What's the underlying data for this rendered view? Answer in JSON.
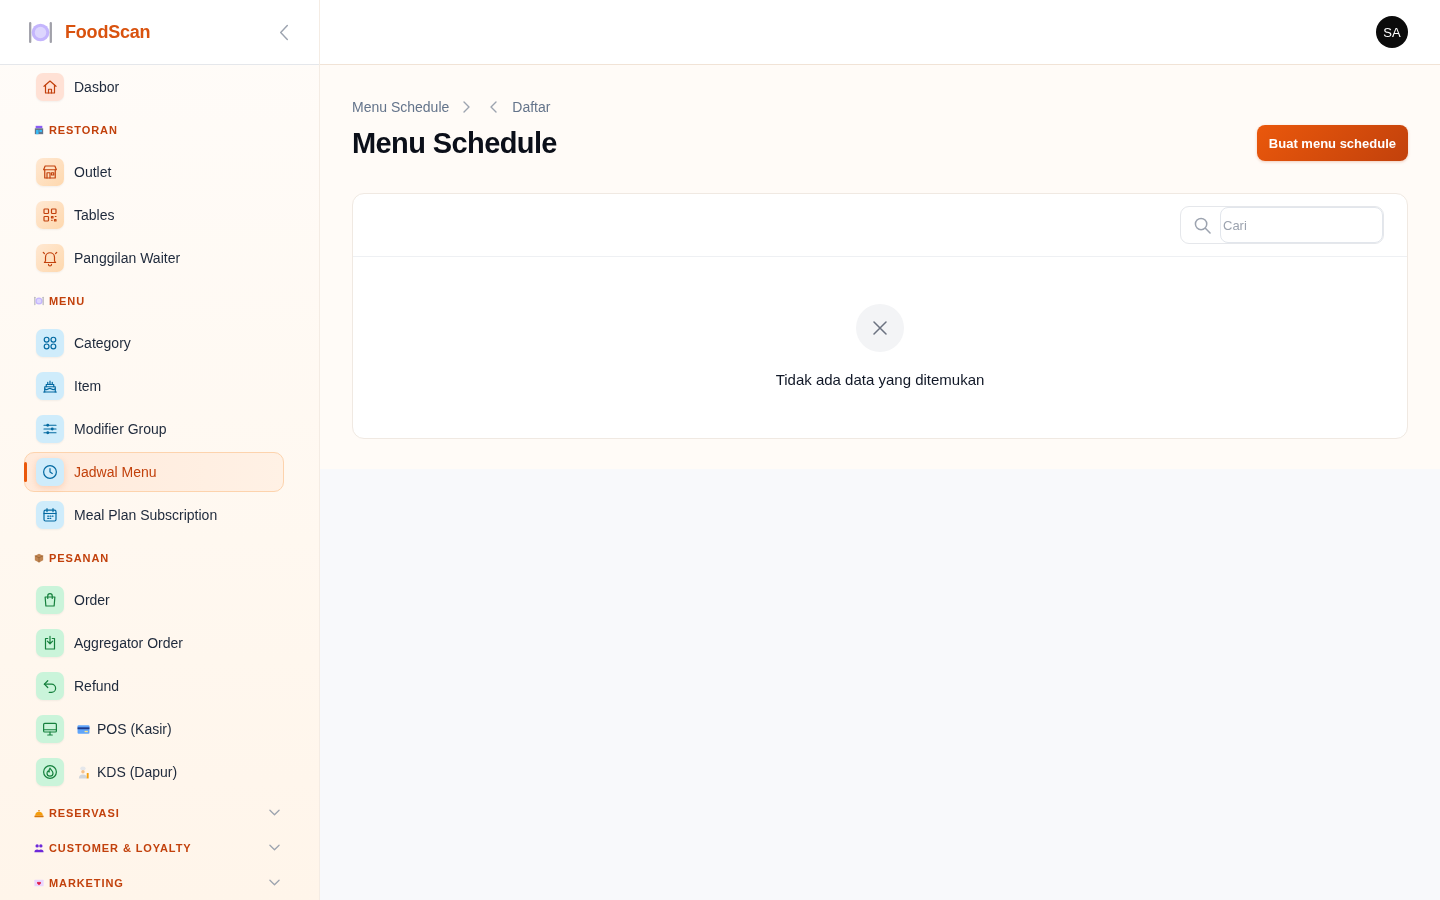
{
  "sidebar": {
    "brand": "FoodScan",
    "items": [
      {
        "label": "Dasbor",
        "selected": false
      }
    ],
    "sections": [
      {
        "title": "RESTORAN",
        "kind": "group",
        "items": [
          {
            "label": "Outlet",
            "selected": false
          },
          {
            "label": "Tables",
            "selected": false
          },
          {
            "label": "Panggilan Waiter",
            "selected": false
          }
        ]
      },
      {
        "title": "MENU",
        "kind": "group",
        "items": [
          {
            "label": "Category",
            "selected": false
          },
          {
            "label": "Item",
            "selected": false
          },
          {
            "label": "Modifier Group",
            "selected": false
          },
          {
            "label": "Jadwal Menu",
            "selected": true
          },
          {
            "label": "Meal Plan Subscription",
            "selected": false
          }
        ]
      },
      {
        "title": "PESANAN",
        "kind": "group",
        "items": [
          {
            "label": "Order",
            "selected": false
          },
          {
            "label": "Aggregator Order",
            "selected": false
          },
          {
            "label": "Refund",
            "selected": false
          },
          {
            "label": "POS (Kasir)",
            "selected": false
          },
          {
            "label": "KDS (Dapur)",
            "selected": false
          }
        ]
      },
      {
        "title": "RESERVASI",
        "kind": "collapsible",
        "expanded": false
      },
      {
        "title": "CUSTOMER & LOYALTY",
        "kind": "collapsible",
        "expanded": false
      },
      {
        "title": "MARKETING",
        "kind": "collapsible",
        "expanded": false
      }
    ]
  },
  "header": {
    "avatar": "SA"
  },
  "breadcrumb": [
    "Menu Schedule",
    "Daftar"
  ],
  "page": {
    "title": "Menu Schedule",
    "primary_button": "Buat menu schedule"
  },
  "table": {
    "search": {
      "placeholder": "Cari"
    },
    "empty_message": "Tidak ada data yang ditemukan"
  }
}
